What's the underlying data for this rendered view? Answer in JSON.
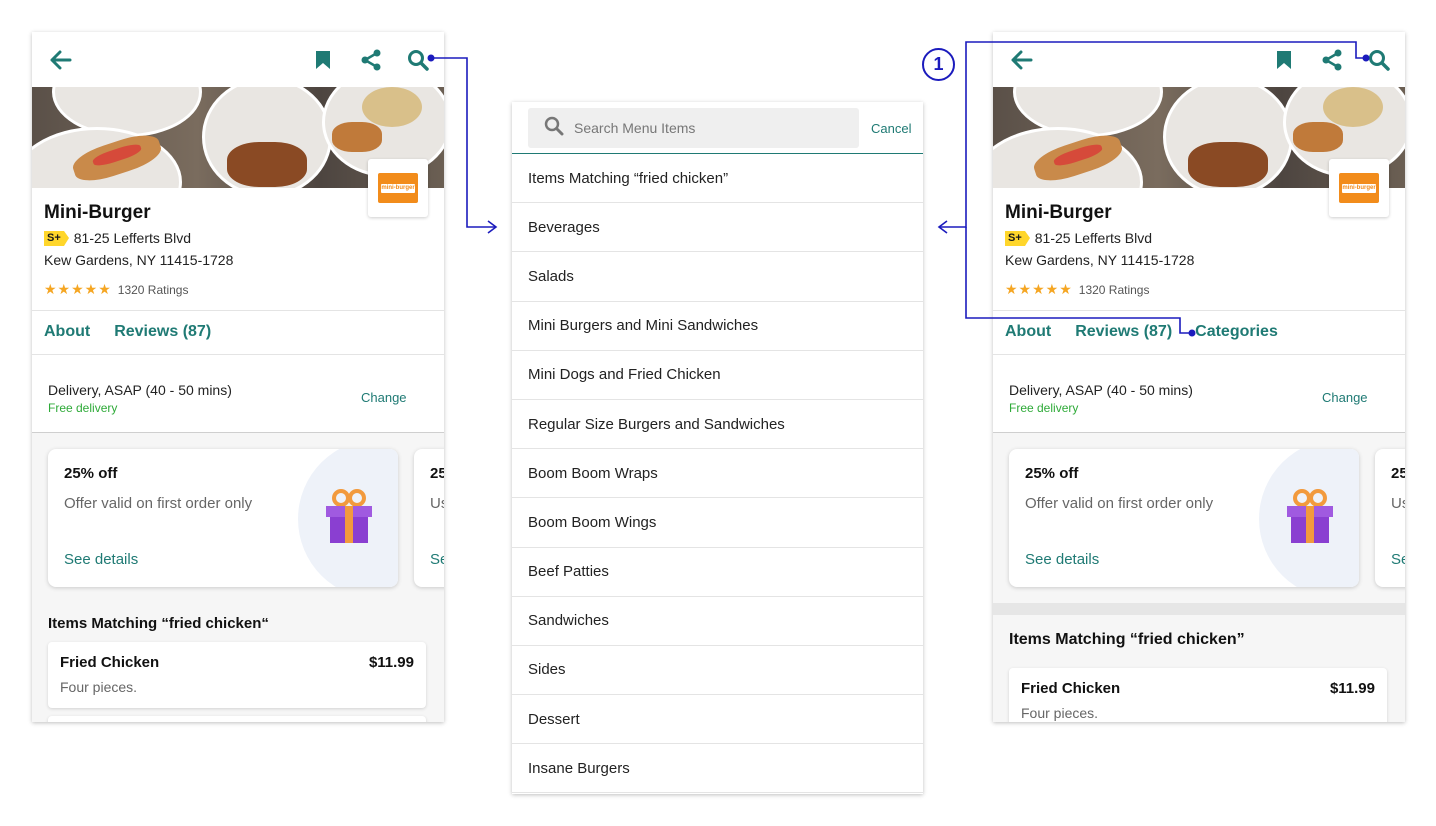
{
  "store": {
    "name": "Mini-Burger",
    "plus_badge": "S+",
    "address_line1": "81-25 Lefferts Blvd",
    "address_line2": "Kew Gardens, NY 11415-1728",
    "stars": "★★★★★",
    "ratings_count": "1320 Ratings",
    "logo_text": "mini-burger"
  },
  "tabs": {
    "about": "About",
    "reviews": "Reviews (87)",
    "categories": "Categories"
  },
  "delivery": {
    "label": "Delivery, ASAP (40 - 50 mins)",
    "free": "Free delivery",
    "change": "Change"
  },
  "promos": [
    {
      "title": "25% off",
      "text": "Offer valid on first order only",
      "link": "See details"
    },
    {
      "title": "25",
      "text": "Us",
      "link": "Se"
    }
  ],
  "results": {
    "title_left": "Items Matching “fried chicken“",
    "title_right": "Items Matching “fried chicken”",
    "items": [
      {
        "name": "Fried Chicken",
        "price": "$11.99",
        "desc": "Four pieces."
      }
    ]
  },
  "search": {
    "placeholder": "Search Menu Items",
    "cancel": "Cancel"
  },
  "categories": [
    "Items Matching “fried chicken”",
    "Beverages",
    "Salads",
    "Mini Burgers and Mini Sandwiches",
    "Mini Dogs and Fried Chicken",
    "Regular Size Burgers and Sandwiches",
    "Boom Boom Wraps",
    "Boom Boom Wings",
    "Beef Patties",
    "Sandwiches",
    "Sides",
    "Dessert",
    "Insane Burgers"
  ],
  "annotation": {
    "badge": "1",
    "line_color": "#1b1bbd"
  },
  "colors": {
    "accent": "#1f7a74",
    "free_delivery": "#2eaa38",
    "star": "#f5a623",
    "plus_badge": "#ffd62b",
    "gift": "#8a3fd1"
  }
}
